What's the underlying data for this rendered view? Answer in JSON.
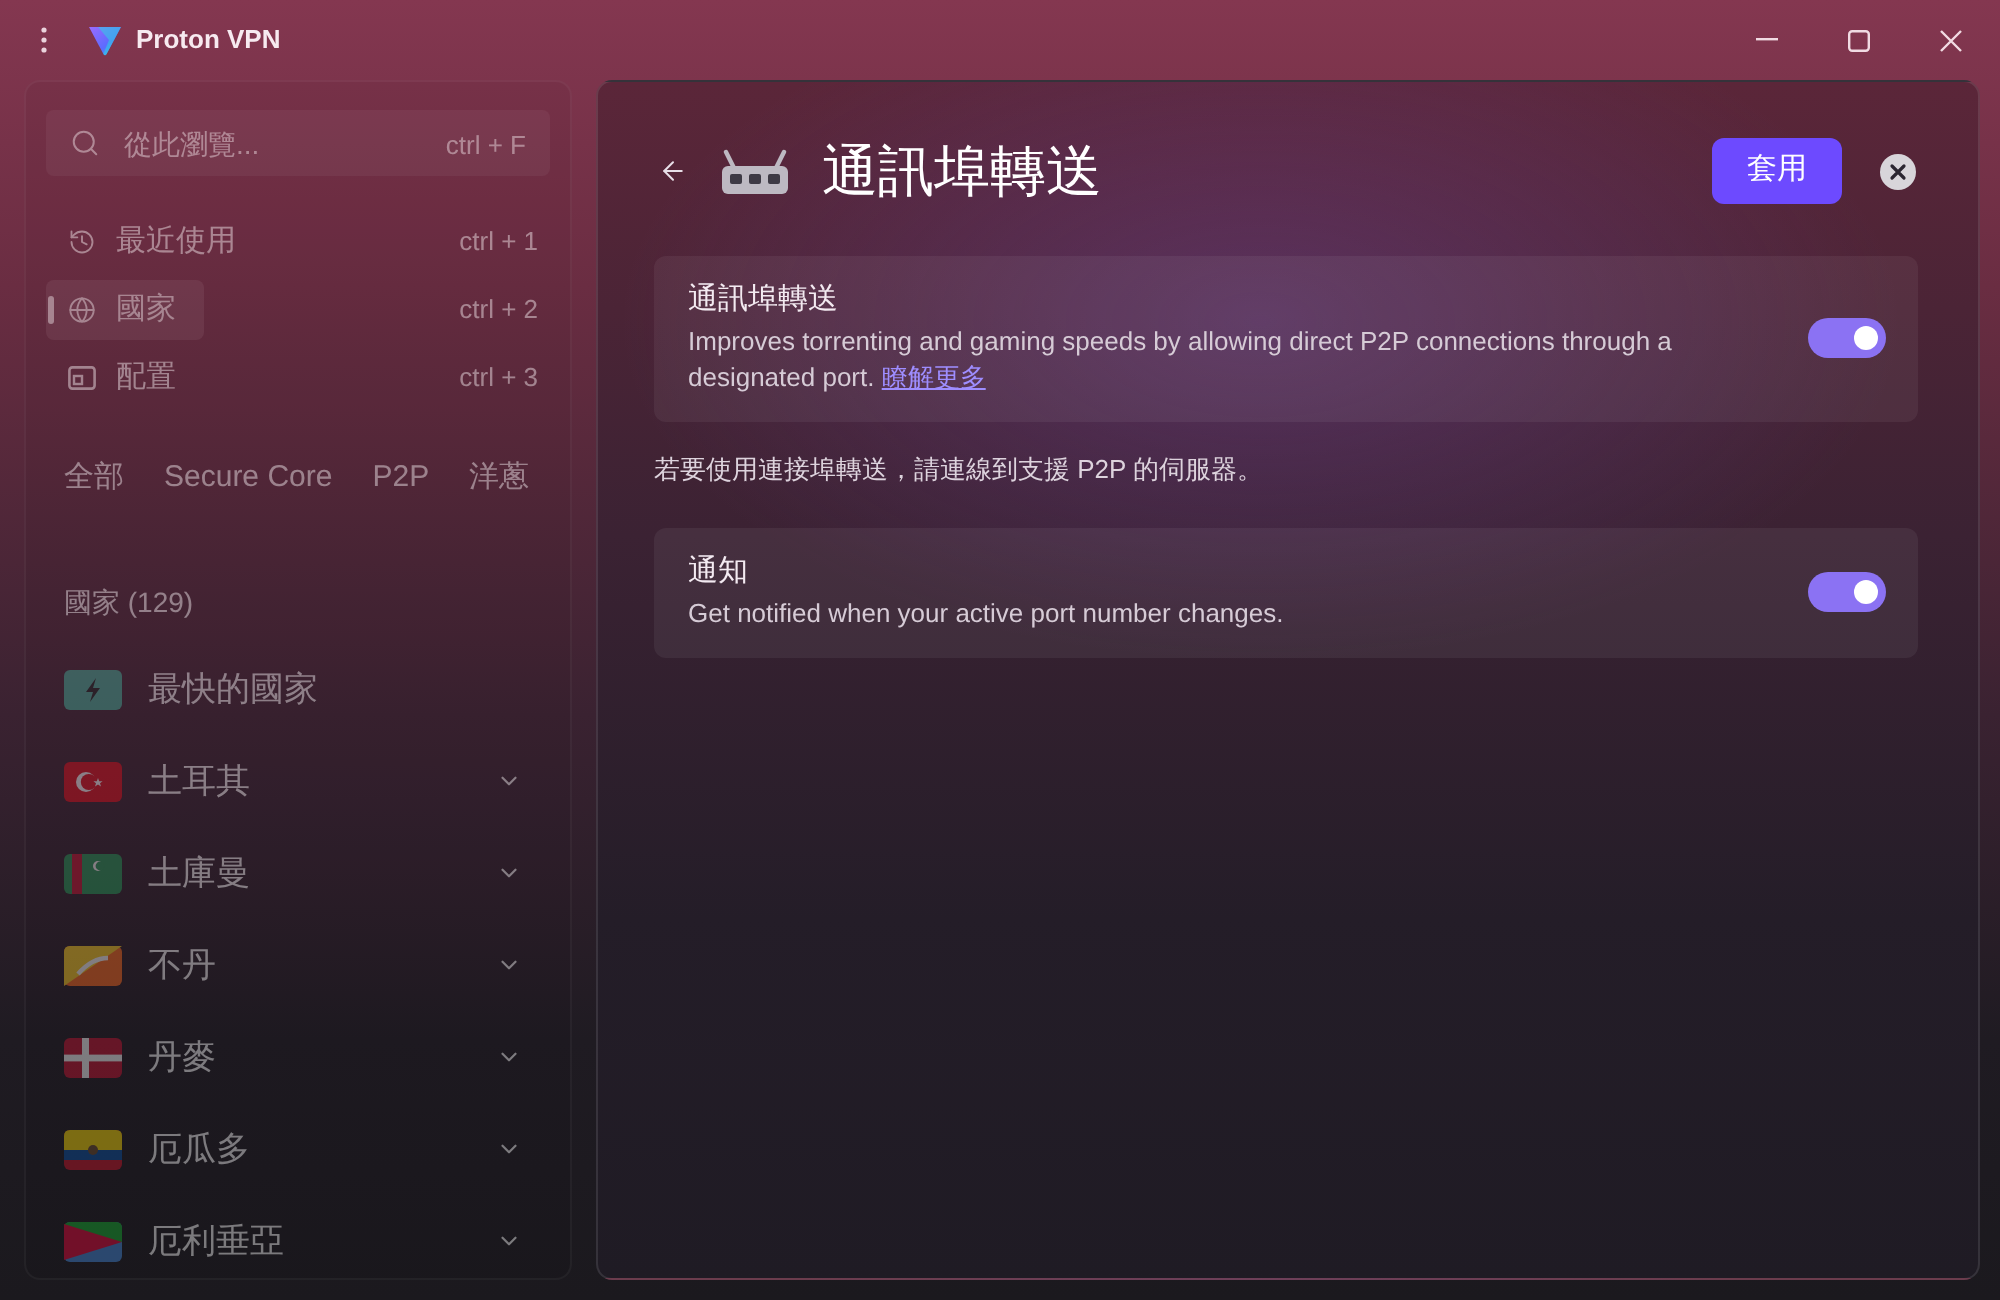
{
  "window": {
    "title": "Proton VPN"
  },
  "sidebar": {
    "dimmed": true,
    "search": {
      "placeholder": "從此瀏覽...",
      "shortcut": "ctrl + F"
    },
    "nav": [
      {
        "label": "最近使用",
        "shortcut": "ctrl + 1",
        "selected": false
      },
      {
        "label": "國家",
        "shortcut": "ctrl + 2",
        "selected": true
      },
      {
        "label": "配置",
        "shortcut": "ctrl + 3",
        "selected": false
      }
    ],
    "filters": [
      "全部",
      "Secure Core",
      "P2P",
      "洋蔥"
    ],
    "countries_heading": "國家 (129)",
    "countries": [
      {
        "kind": "fastest",
        "name": "最快的國家"
      },
      {
        "kind": "country",
        "name": "土耳其"
      },
      {
        "kind": "country",
        "name": "土庫曼"
      },
      {
        "kind": "country",
        "name": "不丹"
      },
      {
        "kind": "country",
        "name": "丹麥"
      },
      {
        "kind": "country",
        "name": "厄瓜多"
      },
      {
        "kind": "country",
        "name": "厄利垂亞"
      }
    ]
  },
  "page": {
    "title": "通訊埠轉送",
    "apply_button": "套用",
    "items": [
      {
        "kind": "toggle",
        "title": "通訊埠轉送",
        "description": "Improves torrenting and gaming speeds by allowing direct P2P connections through a designated port.",
        "link": "瞭解更多",
        "on": true
      },
      {
        "kind": "note",
        "text": "若要使用連接埠轉送，請連線到支援 P2P 的伺服器。"
      },
      {
        "kind": "toggle",
        "title": "通知",
        "description": "Get notified when your active port number changes.",
        "on": true
      }
    ]
  }
}
